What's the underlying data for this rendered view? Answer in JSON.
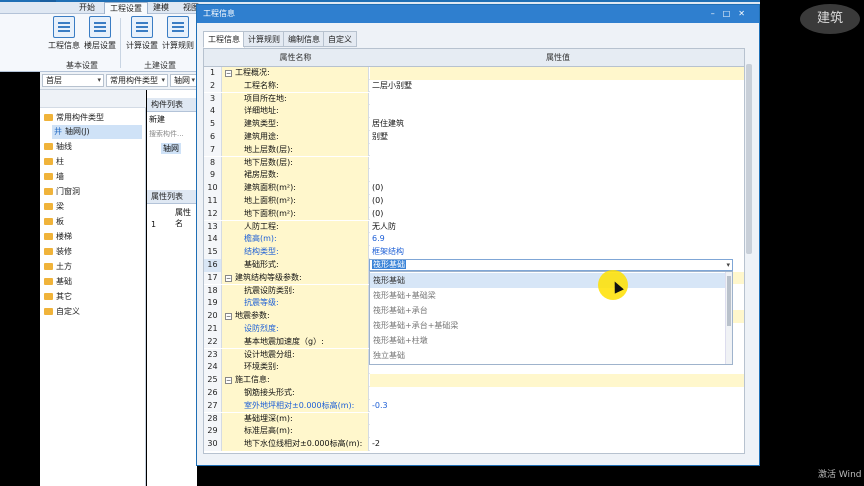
{
  "ribbon": {
    "tabs": [
      "开始",
      "工程设置",
      "建模",
      "视图"
    ],
    "active_tab": "工程设置",
    "buttons": [
      {
        "label": "工程信息",
        "icon": "project-info-icon"
      },
      {
        "label": "楼层设置",
        "icon": "floor-settings-icon"
      },
      {
        "label": "计算设置",
        "icon": "calc-settings-icon"
      },
      {
        "label": "计算规则",
        "icon": "calc-rules-icon"
      }
    ],
    "groups": [
      "基本设置",
      "土建设置"
    ]
  },
  "selectors": {
    "floor": "首层",
    "type": "常用构件类型",
    "axis": "轴网"
  },
  "nav": {
    "root": "常用构件类型",
    "selected_child": "轴网(J)",
    "items": [
      "轴线",
      "柱",
      "墙",
      "门窗洞",
      "梁",
      "板",
      "楼梯",
      "装修",
      "土方",
      "基础",
      "其它",
      "自定义"
    ]
  },
  "component_panel": {
    "title": "构件列表",
    "new_label": "新建",
    "search_placeholder": "搜索构件...",
    "item": "轴网",
    "props_title": "属性列表",
    "props_col": "属性名",
    "props_row": "1"
  },
  "dialog": {
    "title": "工程信息",
    "tabs": [
      "工程信息",
      "计算规则",
      "编制信息",
      "自定义"
    ],
    "active_tab": "工程信息",
    "col_name": "属性名称",
    "col_value": "属性值",
    "rows": [
      {
        "n": "1",
        "name": "工程概况:",
        "value": "",
        "group": true
      },
      {
        "n": "2",
        "name": "工程名称:",
        "value": "二层小别墅"
      },
      {
        "n": "3",
        "name": "项目所在地:",
        "value": ""
      },
      {
        "n": "4",
        "name": "详细地址:",
        "value": ""
      },
      {
        "n": "5",
        "name": "建筑类型:",
        "value": "居住建筑"
      },
      {
        "n": "6",
        "name": "建筑用途:",
        "value": "别墅"
      },
      {
        "n": "7",
        "name": "地上层数(层):",
        "value": ""
      },
      {
        "n": "8",
        "name": "地下层数(层):",
        "value": ""
      },
      {
        "n": "9",
        "name": "裙房层数:",
        "value": ""
      },
      {
        "n": "10",
        "name": "建筑面积(m²):",
        "value": "(0)"
      },
      {
        "n": "11",
        "name": "地上面积(m²):",
        "value": "(0)"
      },
      {
        "n": "12",
        "name": "地下面积(m²):",
        "value": "(0)"
      },
      {
        "n": "13",
        "name": "人防工程:",
        "value": "无人防"
      },
      {
        "n": "14",
        "name": "檐高(m):",
        "value": "6.9",
        "blue": true
      },
      {
        "n": "15",
        "name": "结构类型:",
        "value": "框架结构",
        "blue": true
      },
      {
        "n": "16",
        "name": "基础形式:",
        "value": "",
        "current": true
      },
      {
        "n": "17",
        "name": "建筑结构等级参数:",
        "value": "",
        "group": true
      },
      {
        "n": "18",
        "name": "抗震设防类别:",
        "value": ""
      },
      {
        "n": "19",
        "name": "抗震等级:",
        "value": "",
        "blue": true
      },
      {
        "n": "20",
        "name": "地震参数:",
        "value": "",
        "group": true
      },
      {
        "n": "21",
        "name": "设防烈度:",
        "value": "",
        "blue": true
      },
      {
        "n": "22",
        "name": "基本地震加速度（g）:",
        "value": ""
      },
      {
        "n": "23",
        "name": "设计地震分组:",
        "value": ""
      },
      {
        "n": "24",
        "name": "环境类别:",
        "value": ""
      },
      {
        "n": "25",
        "name": "施工信息:",
        "value": "",
        "group": true
      },
      {
        "n": "26",
        "name": "钢筋接头形式:",
        "value": ""
      },
      {
        "n": "27",
        "name": "室外地坪相对±0.000标高(m):",
        "value": "-0.3",
        "blue": true
      },
      {
        "n": "28",
        "name": "基础埋深(m):",
        "value": ""
      },
      {
        "n": "29",
        "name": "标准层高(m):",
        "value": ""
      },
      {
        "n": "30",
        "name": "地下水位线相对±0.000标高(m):",
        "value": "-2"
      }
    ],
    "dropdown": {
      "selected": "筏形基础",
      "options": [
        "筏形基础",
        "筏形基础+基础梁",
        "筏形基础+承台",
        "筏形基础+承台+基础梁",
        "筏形基础+柱墩",
        "独立基础"
      ]
    }
  },
  "watermark": "建筑",
  "activate_text": "激活 Wind"
}
